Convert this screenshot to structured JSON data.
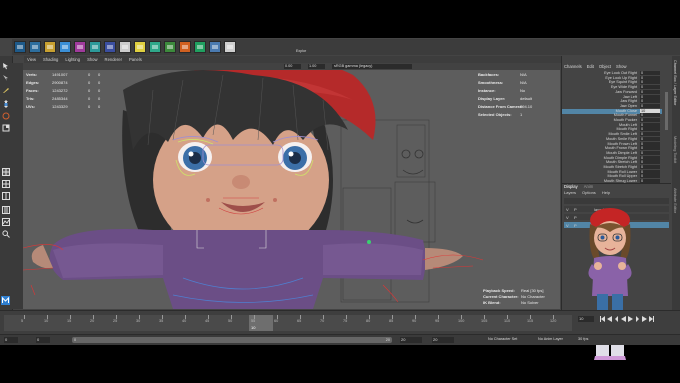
{
  "shelf": {
    "label": "Explor",
    "icons": [
      "#1e5a8a",
      "#2d6e9e",
      "#c8a030",
      "#3b8fd6",
      "#a03a9c",
      "#2c9a9a",
      "#3a4ea0",
      "#cccccc",
      "#e0d040",
      "#2fa88a",
      "#3c8a3c",
      "#d06020",
      "#20a060",
      "#4a7ab0",
      "#cfcfcf"
    ]
  },
  "viewport_menu": [
    "View",
    "Shading",
    "Lighting",
    "Show",
    "Renderer",
    "Panels"
  ],
  "viewport_toolbar": {
    "val1": "0.00",
    "val2": "1.00",
    "colorspace": "sRGB gamma (legacy)"
  },
  "hud_left": [
    {
      "label": "Verts:",
      "v1": "1491007",
      "v2": "0",
      "v3": "0"
    },
    {
      "label": "Edges:",
      "v1": "2900874",
      "v2": "0",
      "v3": "0"
    },
    {
      "label": "Faces:",
      "v1": "1243272",
      "v2": "0",
      "v3": "0"
    },
    {
      "label": "Tris:",
      "v1": "2485344",
      "v2": "0",
      "v3": "0"
    },
    {
      "label": "UVs:",
      "v1": "1243329",
      "v2": "0",
      "v3": "0"
    }
  ],
  "hud_right": [
    {
      "label": "Backfaces:",
      "value": "N/A"
    },
    {
      "label": "Smoothness:",
      "value": "N/A"
    },
    {
      "label": "Instance:",
      "value": "No"
    },
    {
      "label": "Display Layer:",
      "value": "default"
    },
    {
      "label": "Distance From Camera:",
      "value": "294.10"
    },
    {
      "label": "Selected Objects:",
      "value": "1"
    }
  ],
  "hud_bottom": [
    {
      "label": "Playback Speed:",
      "value": "Real [30 fps]"
    },
    {
      "label": "Current Character:",
      "value": "No Character"
    },
    {
      "label": "IK Blend:",
      "value": "No Solver"
    }
  ],
  "channel_box": {
    "menu": [
      "Channels",
      "Edit",
      "Object",
      "Show"
    ],
    "attributes": [
      {
        "name": "Eye Look Out Right",
        "value": "0"
      },
      {
        "name": "Eye Look Up Right",
        "value": "0"
      },
      {
        "name": "Eye Squint Right",
        "value": "0"
      },
      {
        "name": "Eye Wide Right",
        "value": "0"
      },
      {
        "name": "Jaw Forward",
        "value": "0"
      },
      {
        "name": "Jaw Left",
        "value": "0"
      },
      {
        "name": "Jaw Right",
        "value": "0"
      },
      {
        "name": "Jaw Open",
        "value": "0"
      },
      {
        "name": "Mouth Close",
        "value": "10",
        "selected": true
      },
      {
        "name": "Mouth Funnel",
        "value": "0"
      },
      {
        "name": "Mouth Pucker",
        "value": "0"
      },
      {
        "name": "Mouth Left",
        "value": "0"
      },
      {
        "name": "Mouth Right",
        "value": "0"
      },
      {
        "name": "Mouth Smile Left",
        "value": "0"
      },
      {
        "name": "Mouth Smile Right",
        "value": "0"
      },
      {
        "name": "Mouth Frown Left",
        "value": "0"
      },
      {
        "name": "Mouth Frown Right",
        "value": "0"
      },
      {
        "name": "Mouth Dimple Left",
        "value": "0"
      },
      {
        "name": "Mouth Dimple Right",
        "value": "0"
      },
      {
        "name": "Mouth Stretch Left",
        "value": "0"
      },
      {
        "name": "Mouth Stretch Right",
        "value": "0"
      },
      {
        "name": "Mouth Roll Lower",
        "value": "0"
      },
      {
        "name": "Mouth Roll Upper",
        "value": "0"
      },
      {
        "name": "Mouth Shrug Lower",
        "value": "0"
      }
    ]
  },
  "layer_editor": {
    "tabs": [
      "Display",
      "Anim"
    ],
    "menu": [
      "Layers",
      "Options",
      "Help"
    ],
    "layers": [
      {
        "v": "V",
        "p": "P",
        "name": "layer1"
      },
      {
        "v": "V",
        "p": "P",
        "name": "layer2"
      },
      {
        "v": "V",
        "p": "P",
        "name": "layer3"
      }
    ]
  },
  "side_tabs": [
    "Channel Box / Layer Editor",
    "Modeling Toolkit",
    "Attribute Editor"
  ],
  "timeline": {
    "ticks": [
      "5",
      "10",
      "15",
      "20",
      "25",
      "30",
      "35",
      "40",
      "45",
      "50",
      "55",
      "60",
      "65",
      "70",
      "75",
      "80",
      "85",
      "90",
      "95",
      "100",
      "105",
      "110",
      "115",
      "120"
    ],
    "current_frame": "10",
    "frame_field": "10"
  },
  "range_slider": {
    "start": "0",
    "inner_start": "0",
    "inner_end": "20",
    "end": "20",
    "fields": [
      "20",
      "20"
    ],
    "character_set": "No Character Set",
    "anim_layer": "No Anim Layer",
    "fps": "30 fps"
  }
}
